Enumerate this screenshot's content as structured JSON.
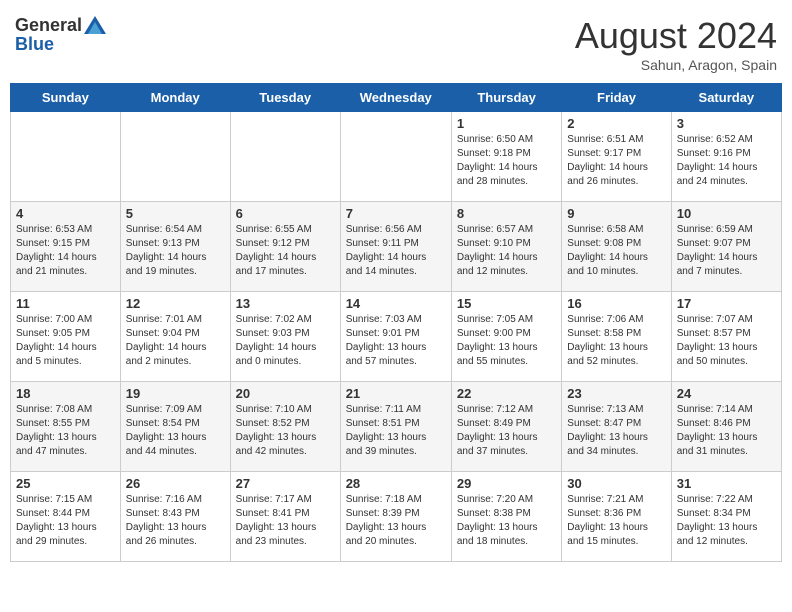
{
  "header": {
    "logo_general": "General",
    "logo_blue": "Blue",
    "month_year": "August 2024",
    "location": "Sahun, Aragon, Spain"
  },
  "weekdays": [
    "Sunday",
    "Monday",
    "Tuesday",
    "Wednesday",
    "Thursday",
    "Friday",
    "Saturday"
  ],
  "weeks": [
    [
      {
        "day": "",
        "info": ""
      },
      {
        "day": "",
        "info": ""
      },
      {
        "day": "",
        "info": ""
      },
      {
        "day": "",
        "info": ""
      },
      {
        "day": "1",
        "info": "Sunrise: 6:50 AM\nSunset: 9:18 PM\nDaylight: 14 hours\nand 28 minutes."
      },
      {
        "day": "2",
        "info": "Sunrise: 6:51 AM\nSunset: 9:17 PM\nDaylight: 14 hours\nand 26 minutes."
      },
      {
        "day": "3",
        "info": "Sunrise: 6:52 AM\nSunset: 9:16 PM\nDaylight: 14 hours\nand 24 minutes."
      }
    ],
    [
      {
        "day": "4",
        "info": "Sunrise: 6:53 AM\nSunset: 9:15 PM\nDaylight: 14 hours\nand 21 minutes."
      },
      {
        "day": "5",
        "info": "Sunrise: 6:54 AM\nSunset: 9:13 PM\nDaylight: 14 hours\nand 19 minutes."
      },
      {
        "day": "6",
        "info": "Sunrise: 6:55 AM\nSunset: 9:12 PM\nDaylight: 14 hours\nand 17 minutes."
      },
      {
        "day": "7",
        "info": "Sunrise: 6:56 AM\nSunset: 9:11 PM\nDaylight: 14 hours\nand 14 minutes."
      },
      {
        "day": "8",
        "info": "Sunrise: 6:57 AM\nSunset: 9:10 PM\nDaylight: 14 hours\nand 12 minutes."
      },
      {
        "day": "9",
        "info": "Sunrise: 6:58 AM\nSunset: 9:08 PM\nDaylight: 14 hours\nand 10 minutes."
      },
      {
        "day": "10",
        "info": "Sunrise: 6:59 AM\nSunset: 9:07 PM\nDaylight: 14 hours\nand 7 minutes."
      }
    ],
    [
      {
        "day": "11",
        "info": "Sunrise: 7:00 AM\nSunset: 9:05 PM\nDaylight: 14 hours\nand 5 minutes."
      },
      {
        "day": "12",
        "info": "Sunrise: 7:01 AM\nSunset: 9:04 PM\nDaylight: 14 hours\nand 2 minutes."
      },
      {
        "day": "13",
        "info": "Sunrise: 7:02 AM\nSunset: 9:03 PM\nDaylight: 14 hours\nand 0 minutes."
      },
      {
        "day": "14",
        "info": "Sunrise: 7:03 AM\nSunset: 9:01 PM\nDaylight: 13 hours\nand 57 minutes."
      },
      {
        "day": "15",
        "info": "Sunrise: 7:05 AM\nSunset: 9:00 PM\nDaylight: 13 hours\nand 55 minutes."
      },
      {
        "day": "16",
        "info": "Sunrise: 7:06 AM\nSunset: 8:58 PM\nDaylight: 13 hours\nand 52 minutes."
      },
      {
        "day": "17",
        "info": "Sunrise: 7:07 AM\nSunset: 8:57 PM\nDaylight: 13 hours\nand 50 minutes."
      }
    ],
    [
      {
        "day": "18",
        "info": "Sunrise: 7:08 AM\nSunset: 8:55 PM\nDaylight: 13 hours\nand 47 minutes."
      },
      {
        "day": "19",
        "info": "Sunrise: 7:09 AM\nSunset: 8:54 PM\nDaylight: 13 hours\nand 44 minutes."
      },
      {
        "day": "20",
        "info": "Sunrise: 7:10 AM\nSunset: 8:52 PM\nDaylight: 13 hours\nand 42 minutes."
      },
      {
        "day": "21",
        "info": "Sunrise: 7:11 AM\nSunset: 8:51 PM\nDaylight: 13 hours\nand 39 minutes."
      },
      {
        "day": "22",
        "info": "Sunrise: 7:12 AM\nSunset: 8:49 PM\nDaylight: 13 hours\nand 37 minutes."
      },
      {
        "day": "23",
        "info": "Sunrise: 7:13 AM\nSunset: 8:47 PM\nDaylight: 13 hours\nand 34 minutes."
      },
      {
        "day": "24",
        "info": "Sunrise: 7:14 AM\nSunset: 8:46 PM\nDaylight: 13 hours\nand 31 minutes."
      }
    ],
    [
      {
        "day": "25",
        "info": "Sunrise: 7:15 AM\nSunset: 8:44 PM\nDaylight: 13 hours\nand 29 minutes."
      },
      {
        "day": "26",
        "info": "Sunrise: 7:16 AM\nSunset: 8:43 PM\nDaylight: 13 hours\nand 26 minutes."
      },
      {
        "day": "27",
        "info": "Sunrise: 7:17 AM\nSunset: 8:41 PM\nDaylight: 13 hours\nand 23 minutes."
      },
      {
        "day": "28",
        "info": "Sunrise: 7:18 AM\nSunset: 8:39 PM\nDaylight: 13 hours\nand 20 minutes."
      },
      {
        "day": "29",
        "info": "Sunrise: 7:20 AM\nSunset: 8:38 PM\nDaylight: 13 hours\nand 18 minutes."
      },
      {
        "day": "30",
        "info": "Sunrise: 7:21 AM\nSunset: 8:36 PM\nDaylight: 13 hours\nand 15 minutes."
      },
      {
        "day": "31",
        "info": "Sunrise: 7:22 AM\nSunset: 8:34 PM\nDaylight: 13 hours\nand 12 minutes."
      }
    ]
  ]
}
